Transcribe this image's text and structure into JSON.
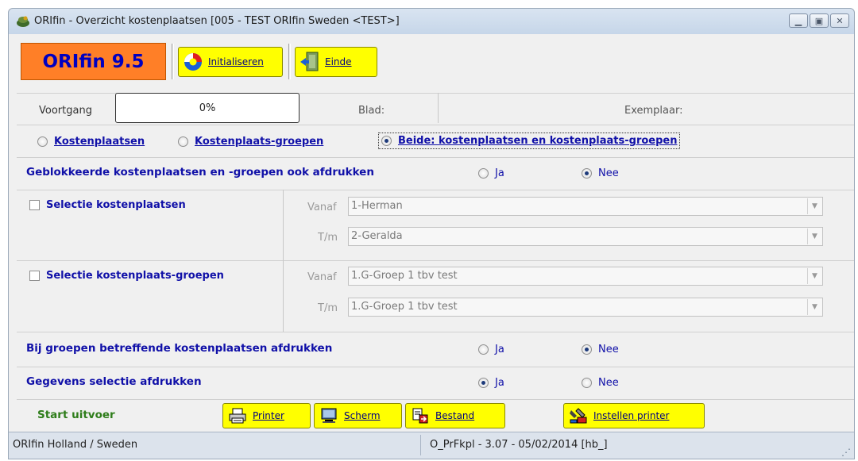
{
  "window": {
    "title": "ORIfin - Overzicht kostenplaatsen [005 - TEST ORIfin Sweden <TEST>]",
    "controls": [
      "minimize",
      "maximize",
      "close"
    ]
  },
  "toolbar": {
    "logo_text": "ORIfin 9.5",
    "initialiseren_label": "Initialiseren",
    "einde_label": "Einde"
  },
  "progress": {
    "label": "Voortgang",
    "value": "0%",
    "blad_label": "Blad:",
    "exemplaar_label": "Exemplaar:"
  },
  "type_options": {
    "items": [
      "Kostenplaatsen",
      "Kostenplaats-groepen",
      "Beide: kostenplaatsen en kostenplaats-groepen"
    ],
    "selected": "Beide: kostenplaatsen en kostenplaats-groepen"
  },
  "geblokkeerd": {
    "label": "Geblokkeerde kostenplaatsen en -groepen ook afdrukken",
    "ja": "Ja",
    "nee": "Nee",
    "selected": "Nee"
  },
  "selectie_kp": {
    "label": "Selectie kostenplaatsen",
    "checked": false,
    "vanaf_label": "Vanaf",
    "vanaf_value": "1-Herman",
    "tm_label": "T/m",
    "tm_value": "2-Geralda"
  },
  "selectie_kpg": {
    "label": "Selectie kostenplaats-groepen",
    "checked": false,
    "vanaf_label": "Vanaf",
    "vanaf_value": "1.G-Groep 1 tbv test",
    "tm_label": "T/m",
    "tm_value": "1.G-Groep 1 tbv test"
  },
  "bij_groepen": {
    "label": "Bij groepen betreffende kostenplaatsen afdrukken",
    "ja": "Ja",
    "nee": "Nee",
    "selected": "Nee"
  },
  "gegevens": {
    "label": "Gegevens selectie afdrukken",
    "ja": "Ja",
    "nee": "Nee",
    "selected": "Ja"
  },
  "uitvoer": {
    "label": "Start uitvoer",
    "printer": "Printer",
    "scherm": "Scherm",
    "bestand": "Bestand",
    "instellen": "Instellen printer"
  },
  "statusbar": {
    "left": "ORIfin Holland / Sweden",
    "center": "O_PrFkpl - 3.07 - 05/02/2014 [hb_]"
  },
  "colors": {
    "accent_blue": "#1010a8",
    "button_yellow": "#ffff00",
    "logo_orange": "#ff7f27",
    "uitvoer_green": "#2e7d1a"
  }
}
